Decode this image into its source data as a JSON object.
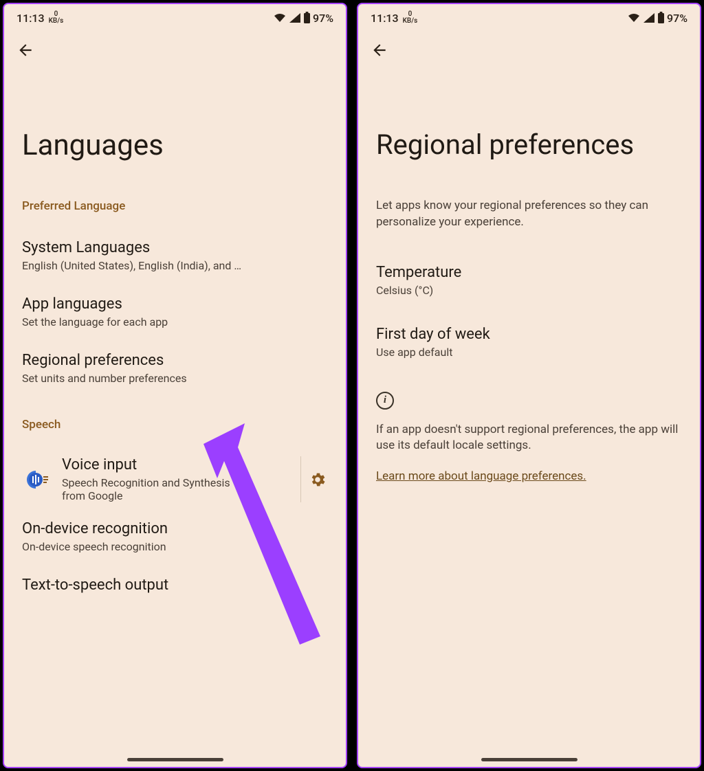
{
  "statusbar": {
    "time": "11:13",
    "net_top": "0",
    "net_bottom": "KB/s",
    "battery": "97%"
  },
  "left": {
    "title": "Languages",
    "section_preferred": "Preferred Language",
    "system_languages": {
      "title": "System Languages",
      "sub": "English (United States), English (India), and …"
    },
    "app_languages": {
      "title": "App languages",
      "sub": "Set the language for each app"
    },
    "regional_prefs": {
      "title": "Regional preferences",
      "sub": "Set units and number preferences"
    },
    "section_speech": "Speech",
    "voice_input": {
      "title": "Voice input",
      "sub": "Speech Recognition and Synthesis from Google"
    },
    "on_device": {
      "title": "On-device recognition",
      "sub": "On-device speech recognition"
    },
    "tts": {
      "title": "Text-to-speech output"
    }
  },
  "right": {
    "title": "Regional preferences",
    "desc": "Let apps know your regional preferences so they can personalize your experience.",
    "temperature": {
      "title": "Temperature",
      "sub": "Celsius (°C)"
    },
    "first_day": {
      "title": "First day of week",
      "sub": "Use app default"
    },
    "info_note": "If an app doesn't support regional preferences, the app will use its default locale settings.",
    "learn_more": "Learn more about language preferences."
  }
}
